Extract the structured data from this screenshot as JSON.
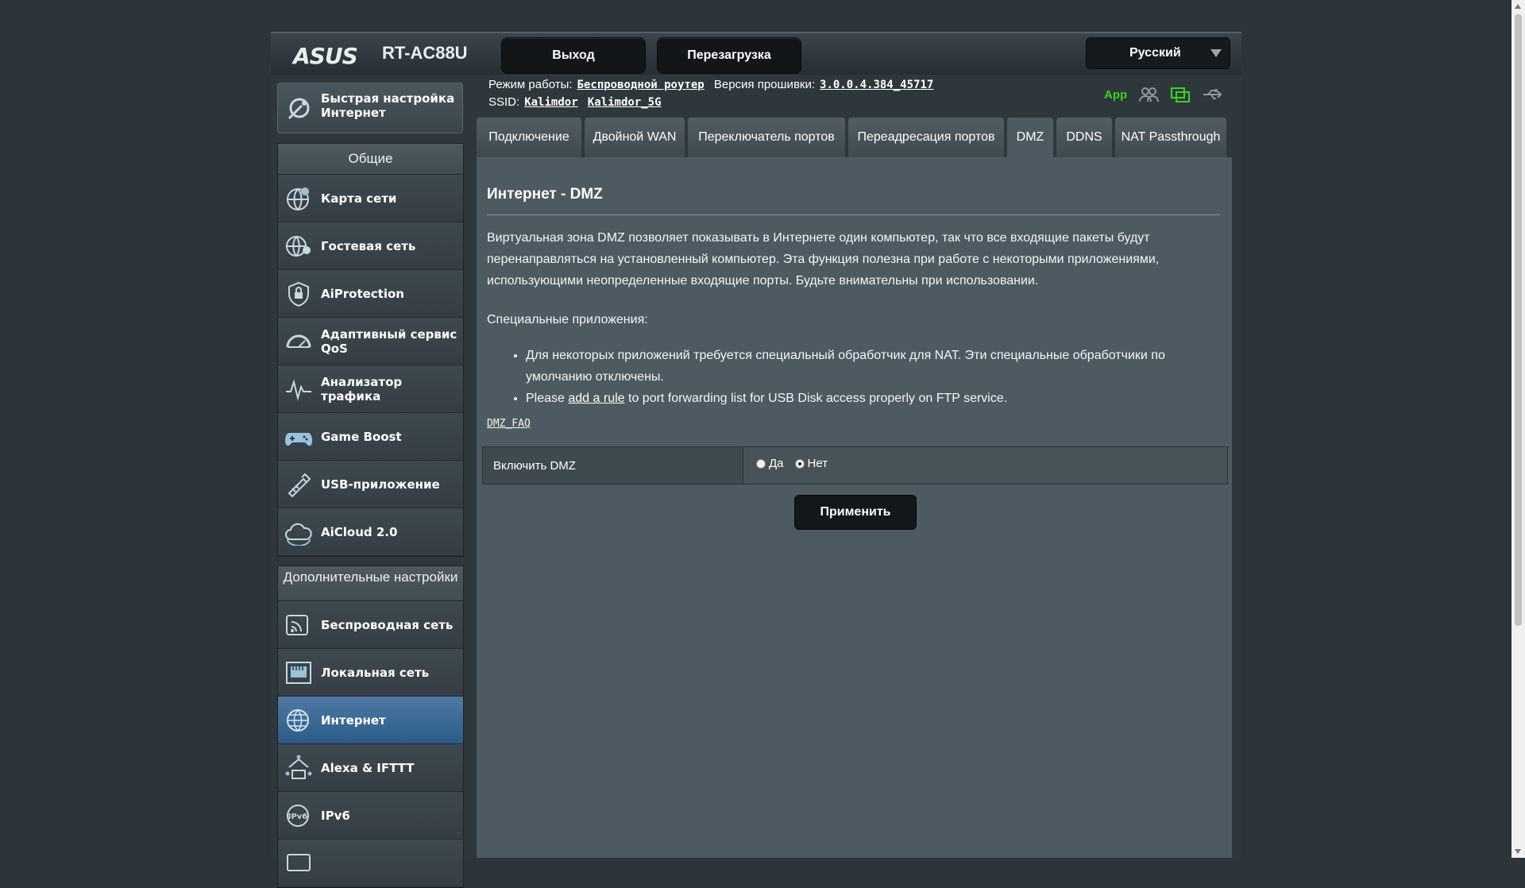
{
  "header": {
    "brand": "ASUS",
    "model": "RT-AC88U",
    "logout_label": "Выход",
    "reboot_label": "Перезагрузка",
    "language": "Русский"
  },
  "info": {
    "mode_label": "Режим работы:",
    "mode_value": "Беспроводной роутер",
    "fw_label": "Версия прошивки:",
    "fw_value": "3.0.0.4.384_45717",
    "ssid_label": "SSID:",
    "ssid_1": "Kalimdor",
    "ssid_2": "Kalimdor_5G",
    "app_label": "App"
  },
  "sidebar": {
    "quick_setup": "Быстрая настройка Интернет",
    "general_title": "Общие",
    "general_items": [
      {
        "label": "Карта сети",
        "icon": "network-map-icon"
      },
      {
        "label": "Гостевая сеть",
        "icon": "guest-network-icon"
      },
      {
        "label": "AiProtection",
        "icon": "aiprotection-shield-icon"
      },
      {
        "label": "Адаптивный сервис QoS",
        "icon": "qos-gauge-icon"
      },
      {
        "label": "Анализатор трафика",
        "icon": "traffic-analyzer-icon"
      },
      {
        "label": "Game Boost",
        "icon": "gamepad-icon"
      },
      {
        "label": "USB-приложение",
        "icon": "usb-app-icon"
      },
      {
        "label": "AiCloud 2.0",
        "icon": "cloud-icon"
      }
    ],
    "advanced_title": "Дополнительные настройки",
    "advanced_items": [
      {
        "label": "Беспроводная сеть",
        "icon": "wireless-icon"
      },
      {
        "label": "Локальная сеть",
        "icon": "lan-icon"
      },
      {
        "label": "Интернет",
        "icon": "globe-icon"
      },
      {
        "label": "Alexa & IFTTT",
        "icon": "alexa-icon"
      },
      {
        "label": "IPv6",
        "icon": "ipv6-icon"
      }
    ]
  },
  "tabs": [
    {
      "label": "Подключение"
    },
    {
      "label": "Двойной WAN"
    },
    {
      "label": "Переключатель портов"
    },
    {
      "label": "Переадресация портов"
    },
    {
      "label": "DMZ"
    },
    {
      "label": "DDNS"
    },
    {
      "label": "NAT Passthrough"
    }
  ],
  "content": {
    "title": "Интернет - DMZ",
    "description": "Виртуальная зона DMZ позволяет показывать в Интернете один компьютер, так что все входящие пакеты будут перенаправляться на установленный компьютер. Эта функция полезна при работе с некоторыми приложениями, использующими неопределенные входящие порты. Будьте внимательны при использовании.",
    "special_label": "Специальные приложения:",
    "bullet_1": "Для некоторых приложений требуется специальный обработчик для NAT. Эти специальные обработчики по умолчанию отключены.",
    "bullet_2_pre": "Please",
    "bullet_2_link": "add a rule",
    "bullet_2_post": "to port forwarding list for USB Disk access properly on FTP service.",
    "faq_link": "DMZ_FAQ",
    "enable_label": "Включить DMZ",
    "opt_yes": "Да",
    "opt_no": "Нет",
    "selected": "Нет",
    "apply_label": "Применить"
  },
  "colors": {
    "background": "#2b353b",
    "panel": "#4d5a61",
    "active_nav": "#2c5b88",
    "app_green": "#39d21f"
  }
}
